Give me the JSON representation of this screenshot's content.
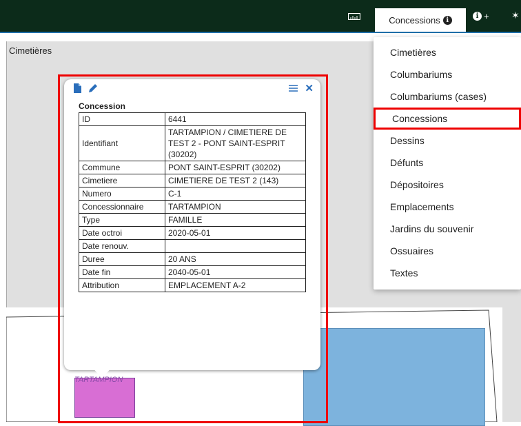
{
  "topbar": {
    "ruler_icon": "ruler-icon",
    "active_tab": {
      "label": "Concessions",
      "icon": "info-circle-icon"
    },
    "info_plus_label": "+",
    "wand_icon": "magic-wand-icon"
  },
  "map": {
    "layer_label": "Cimetières",
    "parcel_label": "TARTAMPION"
  },
  "popup": {
    "tools_left": [
      "file-icon",
      "pencil-icon"
    ],
    "tools_right": [
      "list-icon",
      "close-icon"
    ],
    "title": "Concession",
    "rows": [
      {
        "key": "ID",
        "value": "6441"
      },
      {
        "key": "Identifiant",
        "value": "TARTAMPION / CIMETIERE DE TEST 2 - PONT SAINT-ESPRIT (30202)"
      },
      {
        "key": "Commune",
        "value": "PONT SAINT-ESPRIT (30202)"
      },
      {
        "key": "Cimetiere",
        "value": "CIMETIERE DE TEST 2 (143)"
      },
      {
        "key": "Numero",
        "value": "C-1"
      },
      {
        "key": "Concessionnaire",
        "value": "TARTAMPION"
      },
      {
        "key": "Type",
        "value": "FAMILLE"
      },
      {
        "key": "Date octroi",
        "value": "2020-05-01"
      },
      {
        "key": "Date renouv.",
        "value": ""
      },
      {
        "key": "Duree",
        "value": "20 ANS"
      },
      {
        "key": "Date fin",
        "value": "2040-05-01"
      },
      {
        "key": "Attribution",
        "value": "EMPLACEMENT A-2"
      }
    ]
  },
  "menu": {
    "items": [
      {
        "label": "Cimetières"
      },
      {
        "label": "Columbariums"
      },
      {
        "label": "Columbariums (cases)"
      },
      {
        "label": "Concessions",
        "selected": true
      },
      {
        "label": "Dessins"
      },
      {
        "label": "Défunts"
      },
      {
        "label": "Dépositoires"
      },
      {
        "label": "Emplacements"
      },
      {
        "label": "Jardins du souvenir"
      },
      {
        "label": "Ossuaires"
      },
      {
        "label": "Textes"
      }
    ]
  },
  "colors": {
    "topbar": "#0c2b1a",
    "highlight": "#e00000",
    "accent": "#2a6ebb",
    "parcel_blue": "#7db3dd",
    "parcel_pink": "#d86ed4"
  }
}
